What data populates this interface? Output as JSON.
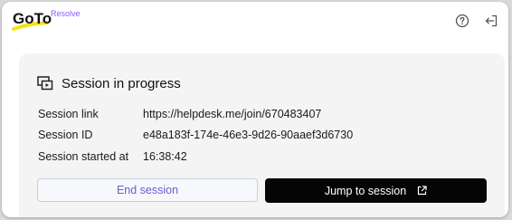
{
  "header": {
    "logo_text": "GoTo",
    "logo_sub": "Resolve",
    "help_icon": "question-circle-icon",
    "logout_icon": "sign-out-icon"
  },
  "card": {
    "title": "Session in progress",
    "title_icon": "screen-share-icon",
    "rows": [
      {
        "label": "Session link",
        "value": "https://helpdesk.me/join/670483407"
      },
      {
        "label": "Session ID",
        "value": "e48a183f-174e-46e3-9d26-90aaef3d6730"
      },
      {
        "label": "Session started at",
        "value": "16:38:42"
      }
    ],
    "end_button": "End session",
    "jump_button": "Jump to session",
    "jump_icon": "external-link-icon"
  },
  "colors": {
    "logo_underline": "#f5e216",
    "resolve_purple": "#8a5cf6",
    "end_button_text": "#6b5bd6",
    "jump_button_bg": "#050505",
    "card_bg": "#f4f4f4"
  }
}
